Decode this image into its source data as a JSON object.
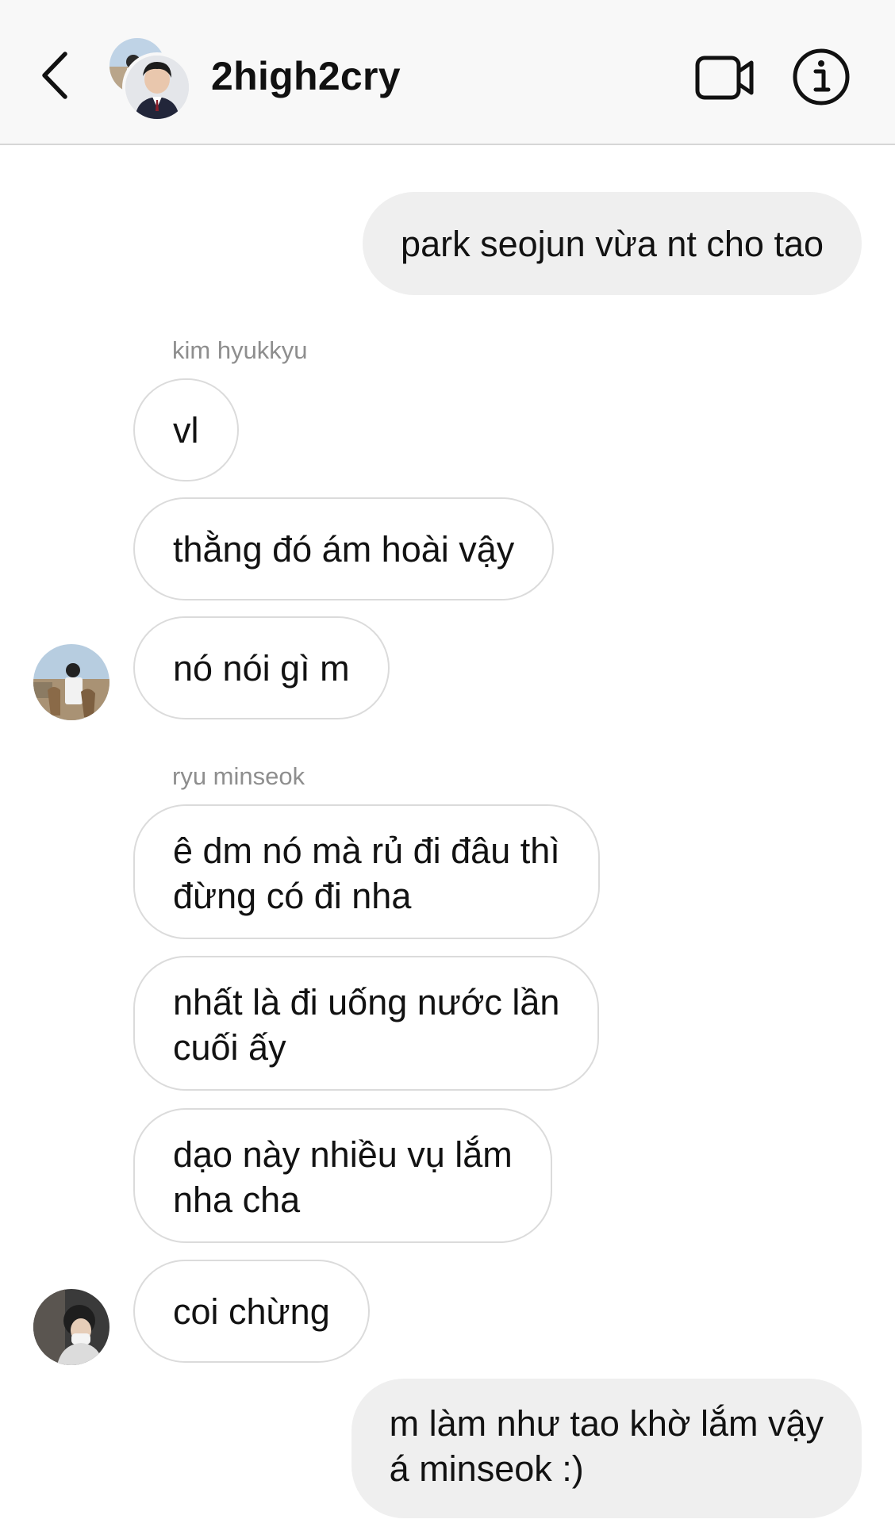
{
  "header": {
    "title": "2high2cry",
    "back_icon": "chevron-left-icon",
    "video_icon": "video-camera-icon",
    "info_icon": "info-icon"
  },
  "colors": {
    "outgoing_bubble": "#efefef",
    "incoming_border": "#dbdbdb",
    "sender_name": "#8e8e8e",
    "header_bg": "#f8f8f8"
  },
  "messages": [
    {
      "direction": "out",
      "lines": [
        "park seojun vừa nt cho tao"
      ]
    },
    {
      "direction": "in",
      "sender": "kim hyukkyu",
      "lines": [
        "vl"
      ]
    },
    {
      "direction": "in",
      "lines": [
        "thằng đó ám hoài vậy"
      ]
    },
    {
      "direction": "in",
      "lines": [
        "nó nói gì m"
      ]
    },
    {
      "direction": "in",
      "sender": "ryu minseok",
      "lines": [
        "ê dm nó mà rủ đi đâu thì",
        "đừng có đi nha"
      ]
    },
    {
      "direction": "in",
      "lines": [
        "nhất là đi uống nước lần",
        "cuối ấy"
      ]
    },
    {
      "direction": "in",
      "lines": [
        "dạo này nhiều vụ lắm",
        "nha cha"
      ]
    },
    {
      "direction": "in",
      "lines": [
        "coi chừng"
      ]
    },
    {
      "direction": "out",
      "lines": [
        "m làm như tao khờ lắm vậy",
        "á minseok :)"
      ]
    }
  ]
}
